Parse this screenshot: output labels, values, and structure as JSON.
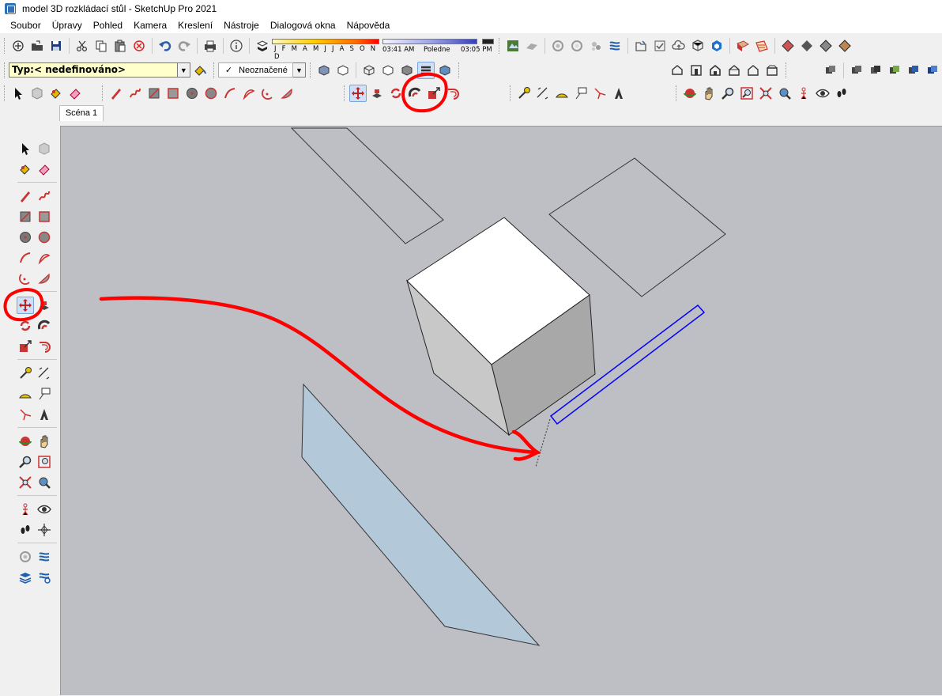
{
  "window": {
    "title": "model 3D rozkládací stůl - SketchUp Pro 2021"
  },
  "menu": [
    "Soubor",
    "Úpravy",
    "Pohled",
    "Kamera",
    "Kreslení",
    "Nástroje",
    "Dialogová okna",
    "Nápověda"
  ],
  "shadows": {
    "months": "J F M A M J J A S O N D",
    "time_start": "03:41 AM",
    "time_mid": "Poledne",
    "time_end": "03:05 PM"
  },
  "entity_info": {
    "type_value": "Typ:< nedefinováno>"
  },
  "tags": {
    "current": "Neoznačené",
    "checked": "✓"
  },
  "scenes": {
    "tabs": [
      "Scéna 1"
    ]
  },
  "annotations": {
    "color": "#ff0000"
  },
  "viewport": {
    "background": "#bdbfc4",
    "face_fill": "#b3c8d8",
    "selection_color": "#0000ff"
  },
  "active_tool": "move-tool"
}
